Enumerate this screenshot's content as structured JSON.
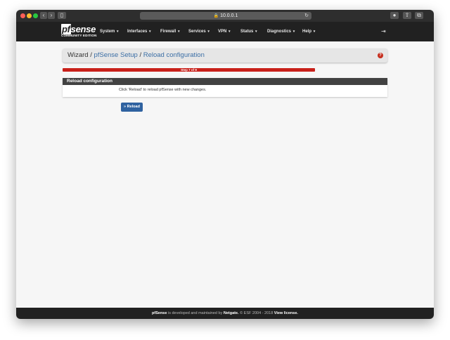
{
  "browser": {
    "url": "10.0.0.1"
  },
  "nav": {
    "logo_text": "sense",
    "logo_pf": "pf",
    "logo_edition": "COMMUNITY EDITION",
    "menu": [
      {
        "label": "System"
      },
      {
        "label": "Interfaces"
      },
      {
        "label": "Firewall"
      },
      {
        "label": "Services"
      },
      {
        "label": "VPN"
      },
      {
        "label": "Status"
      },
      {
        "label": "Diagnostics"
      },
      {
        "label": "Help"
      }
    ]
  },
  "breadcrumb": {
    "wizard": "Wizard",
    "setup": "pfSense Setup",
    "page": "Reload configuration"
  },
  "progress": {
    "text": "Step 7 of 9",
    "fraction": 0.778
  },
  "panel": {
    "title": "Reload configuration",
    "body": "Click 'Reload' to reload pfSense with new changes."
  },
  "button": {
    "reload": "Reload"
  },
  "footer": {
    "brand": "pfSense",
    "text1": " is developed and maintained by ",
    "company": "Netgate.",
    "text2": " © ESF 2004 - 2018 ",
    "license": "View license."
  },
  "colors": {
    "accent": "#3c6fa6",
    "progress": "#c8201a",
    "navbar": "#212121"
  }
}
